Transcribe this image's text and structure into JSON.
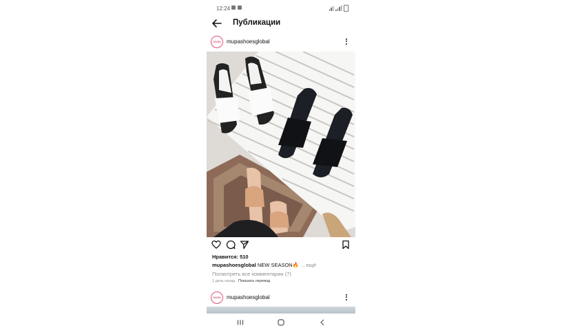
{
  "status_bar": {
    "time": "12:24"
  },
  "header": {
    "title": "Публикации",
    "back_icon": "arrow-left-icon"
  },
  "posts": [
    {
      "username": "mupashoesglobal",
      "avatar_text": "MUBA",
      "likes": "Нравится: 510",
      "caption_user": "mupashoesglobal",
      "caption_text": "NEW SEASON🔥",
      "caption_more": " ... ещё",
      "view_comments": "Посмотреть все комментарии (7)",
      "time_ago": "1 день назад",
      "separator": " · ",
      "translate": "Показать перевод"
    },
    {
      "username": "mupashoesglobal",
      "avatar_text": "MUBA"
    }
  ],
  "icons": {
    "like": "heart-icon",
    "comment": "comment-icon",
    "share": "send-icon",
    "save": "bookmark-icon",
    "more": "more-vertical-icon"
  },
  "navigation": [
    "recent-apps-icon",
    "home-icon",
    "back-icon"
  ]
}
